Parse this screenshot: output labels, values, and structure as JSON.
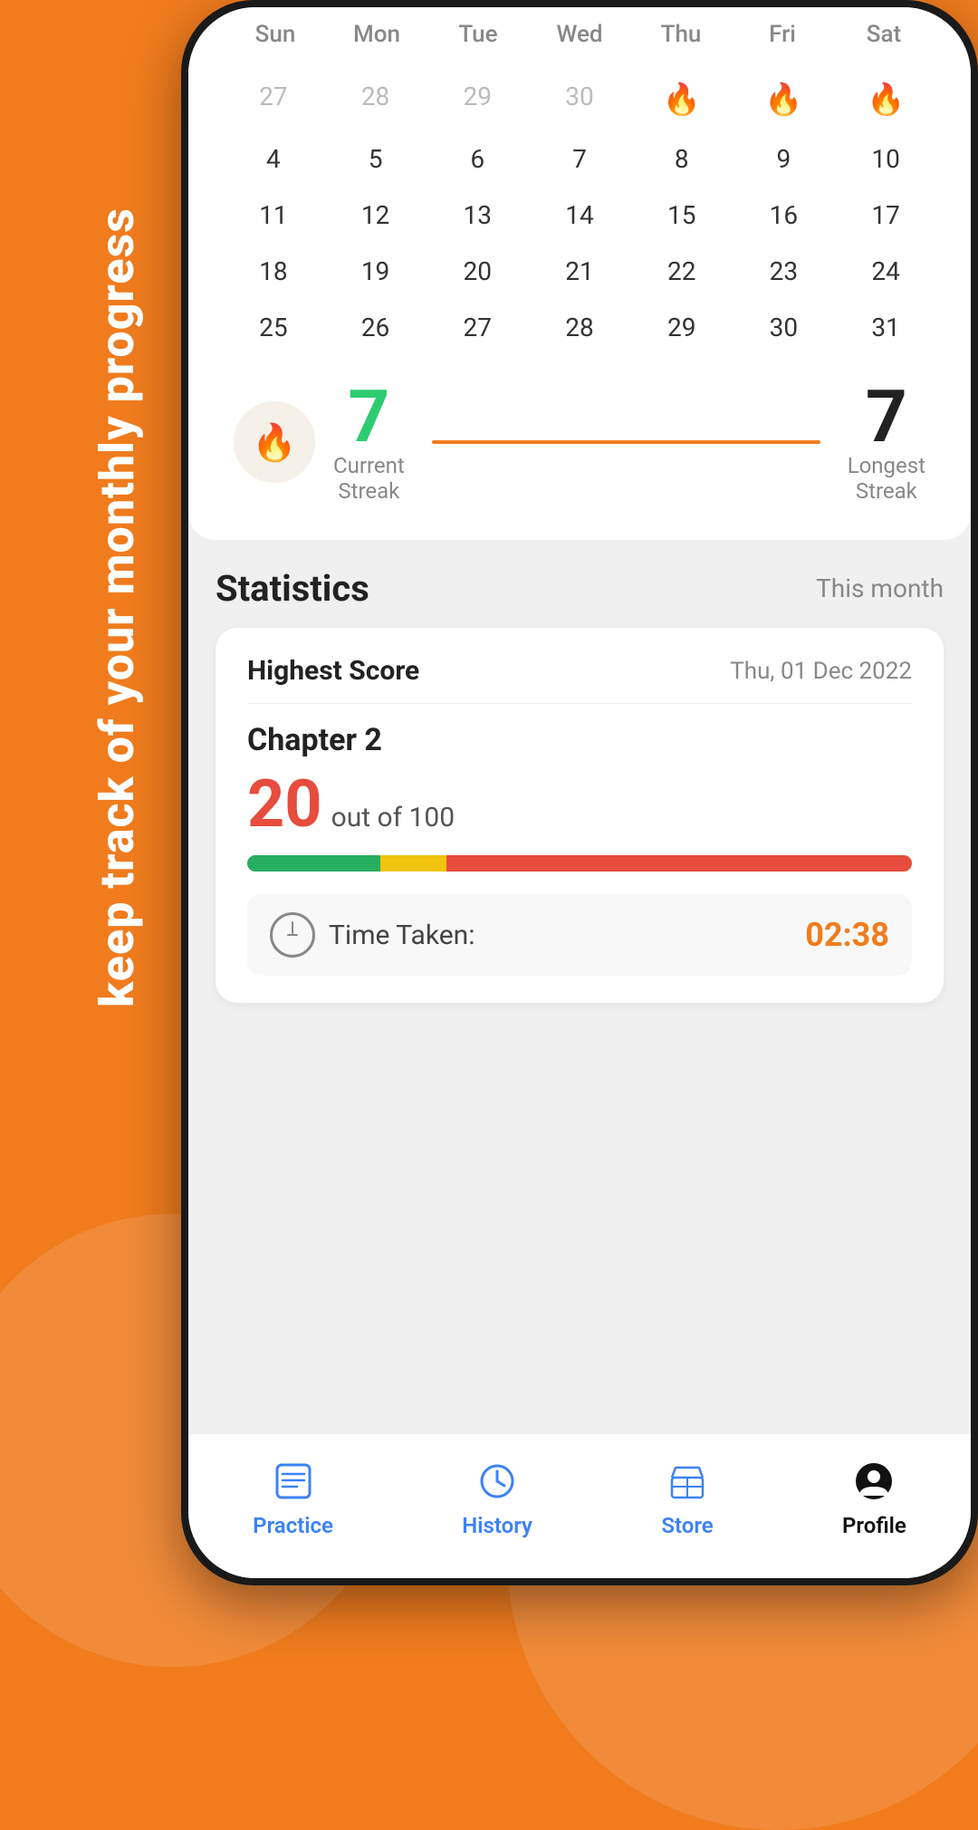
{
  "background": {
    "color": "#F07C1E"
  },
  "sideText": "keep track of your monthly progress",
  "calendar": {
    "headers": [
      "Sun",
      "Mon",
      "Tue",
      "Wed",
      "Thu",
      "Fri",
      "Sat"
    ],
    "weeks": [
      [
        "27",
        "28",
        "29",
        "30",
        "🔥",
        "🔥",
        "🔥"
      ],
      [
        "4",
        "5",
        "6",
        "7",
        "8",
        "9",
        "10"
      ],
      [
        "11",
        "12",
        "13",
        "14",
        "15",
        "16",
        "17"
      ],
      [
        "18",
        "19",
        "20",
        "21",
        "22",
        "23",
        "24"
      ],
      [
        "25",
        "26",
        "27",
        "28",
        "29",
        "30",
        "31"
      ]
    ],
    "fireIndices": [
      [
        0,
        4
      ],
      [
        0,
        5
      ],
      [
        0,
        6
      ]
    ]
  },
  "streak": {
    "currentValue": "7",
    "currentLabel": "Current\nStreak",
    "longestValue": "7",
    "longestLabel": "Longest\nStreak"
  },
  "statistics": {
    "title": "Statistics",
    "period": "This month",
    "card": {
      "highestScoreLabel": "Highest Score",
      "date": "Thu, 01 Dec 2022",
      "chapter": "Chapter 2",
      "score": "20",
      "outOf": "out of 100",
      "timeTakenLabel": "Time Taken:",
      "timeValue": "02:38"
    }
  },
  "bottomNav": {
    "items": [
      {
        "id": "practice",
        "label": "Practice",
        "active": false
      },
      {
        "id": "history",
        "label": "History",
        "active": false
      },
      {
        "id": "store",
        "label": "Store",
        "active": false
      },
      {
        "id": "profile",
        "label": "Profile",
        "active": true
      }
    ]
  }
}
